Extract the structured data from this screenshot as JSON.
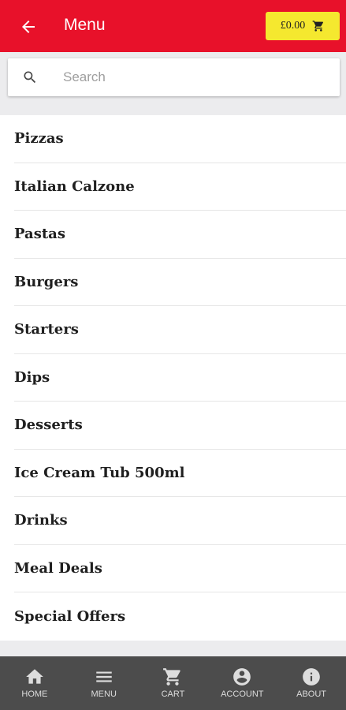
{
  "header": {
    "title": "Menu",
    "back_icon": "arrow-left-icon",
    "cart_amount": "£0.00",
    "cart_icon": "cart-icon",
    "accent_color": "#e8112a",
    "cart_button_color": "#f5e82f"
  },
  "search": {
    "placeholder": "Search",
    "value": "",
    "icon": "search-icon"
  },
  "menu": {
    "items": [
      {
        "label": "Pizzas"
      },
      {
        "label": "Italian Calzone"
      },
      {
        "label": "Pastas"
      },
      {
        "label": "Burgers"
      },
      {
        "label": "Starters"
      },
      {
        "label": "Dips"
      },
      {
        "label": "Desserts"
      },
      {
        "label": "Ice Cream Tub 500ml"
      },
      {
        "label": "Drinks"
      },
      {
        "label": "Meal Deals"
      },
      {
        "label": "Special Offers"
      }
    ]
  },
  "bottom_nav": {
    "background": "#4c4c4c",
    "items": [
      {
        "label": "HOME",
        "icon": "home-icon"
      },
      {
        "label": "MENU",
        "icon": "menu-icon"
      },
      {
        "label": "CART",
        "icon": "cart-icon"
      },
      {
        "label": "ACCOUNT",
        "icon": "account-icon"
      },
      {
        "label": "ABOUT",
        "icon": "info-icon"
      }
    ]
  }
}
